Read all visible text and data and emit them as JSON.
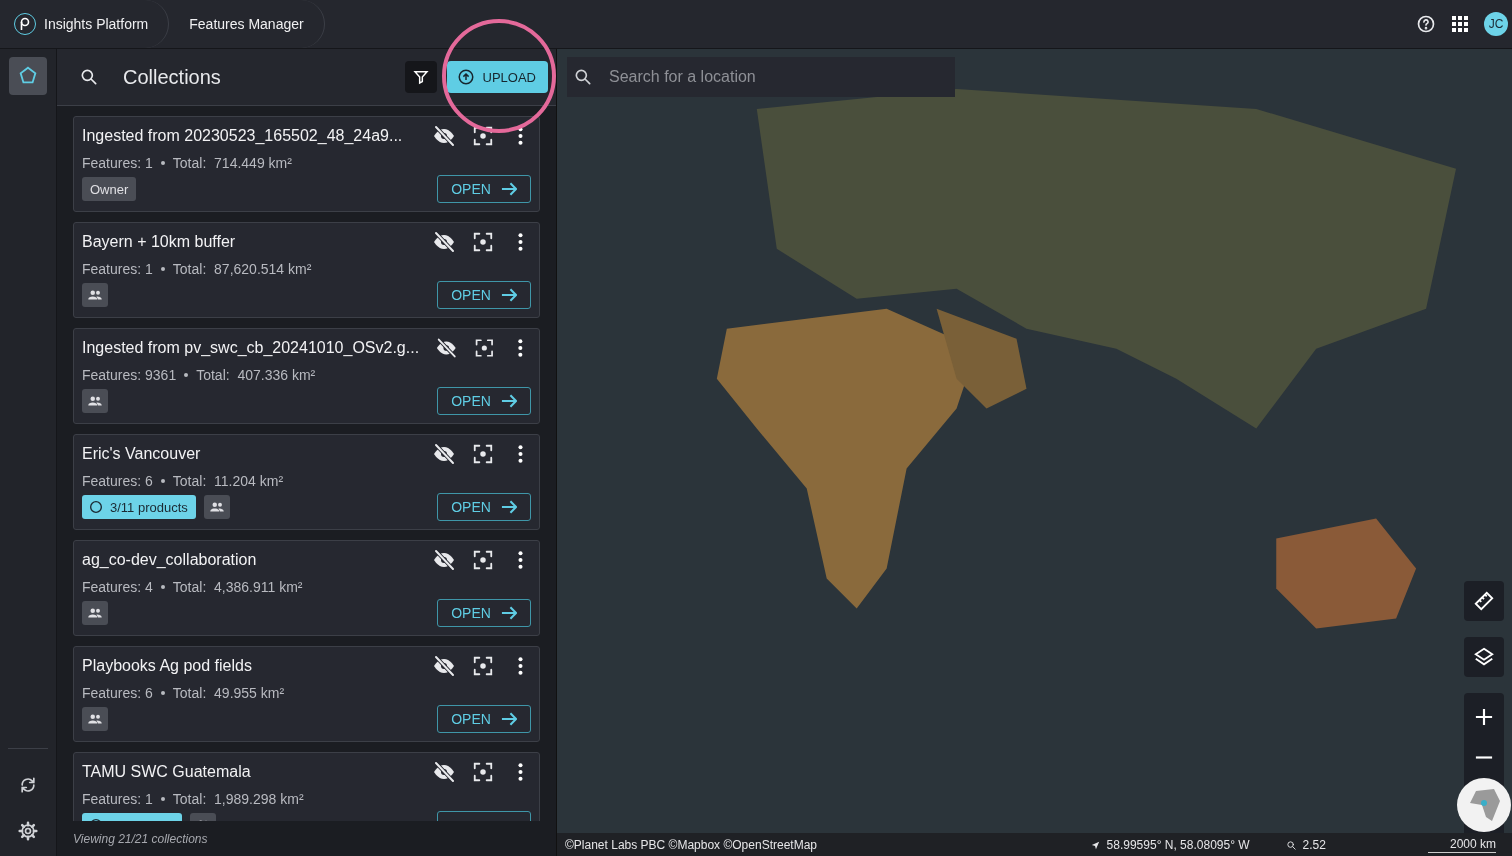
{
  "top_bar": {
    "app_name": "Insights Platform",
    "breadcrumb": "Features Manager",
    "avatar": "JC"
  },
  "side_rail": {
    "items": [
      {
        "kind": "collections",
        "selected": true
      }
    ]
  },
  "panel": {
    "title": "Collections",
    "upload_label": "UPLOAD",
    "footer": "Viewing 21/21 collections",
    "collections": [
      {
        "title": "Ingested from 20230523_165502_48_24a9...",
        "features": "Features: 1",
        "total": "Total:  714.449 km²",
        "open_label": "OPEN",
        "tags": [
          {
            "kind": "owner",
            "label": "Owner"
          }
        ]
      },
      {
        "title": "Bayern + 10km buffer",
        "features": "Features: 1",
        "total": "Total:  87,620.514 km²",
        "open_label": "OPEN",
        "tags": [
          {
            "kind": "shared"
          }
        ]
      },
      {
        "title": "Ingested from pv_swc_cb_20241010_OSv2.g...",
        "features": "Features: 9361",
        "total": "Total:  407.336 km²",
        "open_label": "OPEN",
        "tags": [
          {
            "kind": "shared"
          }
        ]
      },
      {
        "title": "Eric's Vancouver",
        "features": "Features: 6",
        "total": "Total:  11.204 km²",
        "open_label": "OPEN",
        "tags": [
          {
            "kind": "progress",
            "label": "3/11 products"
          },
          {
            "kind": "shared"
          }
        ]
      },
      {
        "title": "ag_co-dev_collaboration",
        "features": "Features: 4",
        "total": "Total:  4,386.911 km²",
        "open_label": "OPEN",
        "tags": [
          {
            "kind": "shared"
          }
        ]
      },
      {
        "title": "Playbooks Ag pod fields",
        "features": "Features: 6",
        "total": "Total:  49.955 km²",
        "open_label": "OPEN",
        "tags": [
          {
            "kind": "shared"
          }
        ]
      },
      {
        "title": "TAMU SWC Guatemala",
        "features": "Features: 1",
        "total": "Total:  1,989.298 km²",
        "tags": [
          {
            "kind": "progress"
          },
          {
            "kind": "shared"
          }
        ]
      }
    ]
  },
  "map": {
    "search_placeholder": "Search for a location",
    "attribution": "©Planet Labs PBC ©Mapbox ©OpenStreetMap",
    "coordinates": "58.99595° N, 58.08095° W",
    "zoom": "2.52",
    "scale": "2000 km"
  }
}
